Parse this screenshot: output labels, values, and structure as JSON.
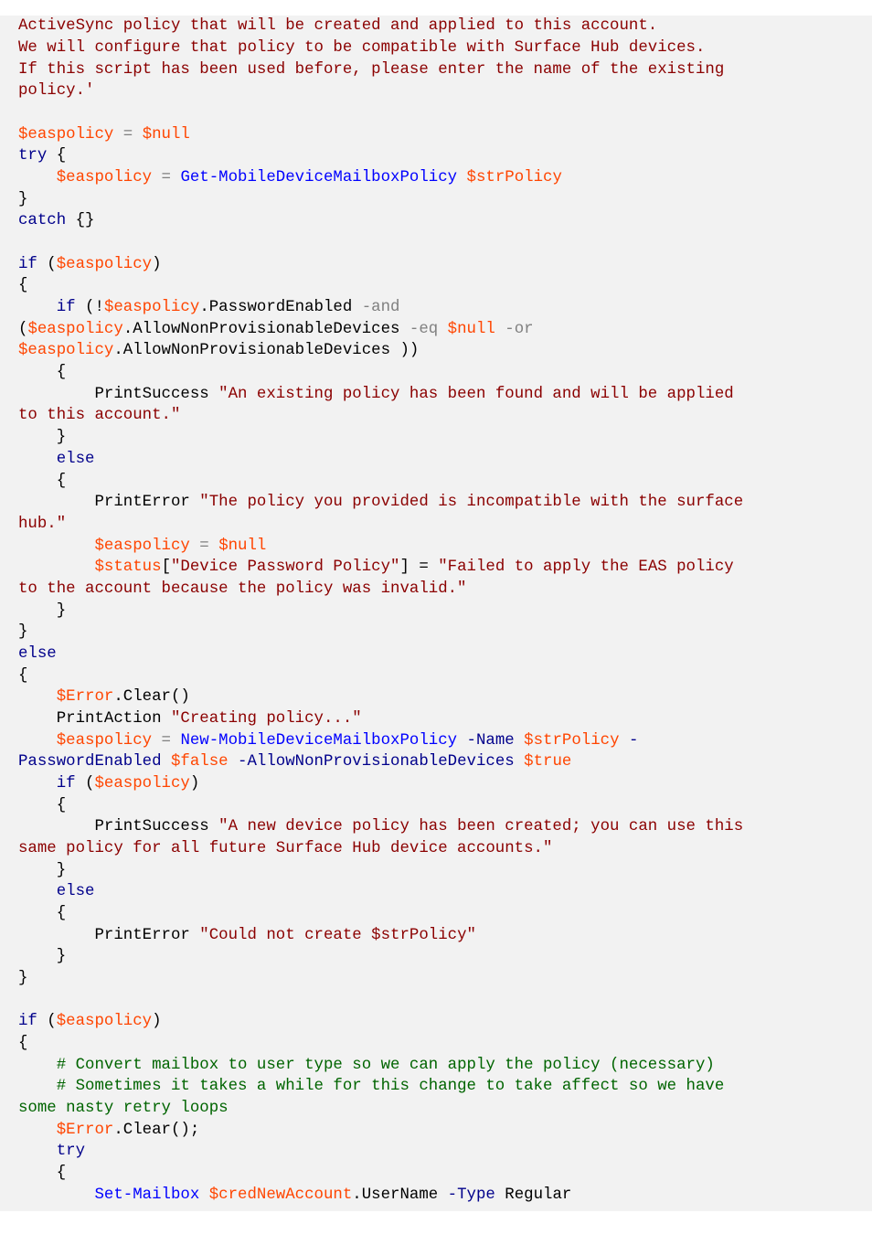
{
  "code": {
    "l01a": "ActiveSync policy that will be created and applied to this account.",
    "l01b": "We will configure that policy to be compatible with Surface Hub devices.",
    "l01c": "If this script has been used before, please enter the name of the existing ",
    "l01d": "policy.'",
    "blank": "",
    "l02_var": "$easpolicy",
    "l02_eq": " = ",
    "l02_null": "$null",
    "l03_try": "try",
    "l03_brace": " {",
    "l04_ind": "    ",
    "l04_var": "$easpolicy",
    "l04_eq": " = ",
    "l04_cmd": "Get-MobileDeviceMailboxPolicy",
    "l04_sp": " ",
    "l04_arg": "$strPolicy",
    "brace_close": "}",
    "l06_catch": "catch",
    "l06_rest": " {}",
    "l08_if": "if",
    "l08_sp": " (",
    "l08_var": "$easpolicy",
    "l08_close": ")",
    "brace_open": "{",
    "l10_ind": "    ",
    "l10_if": "if",
    "l10_a": " (!",
    "l10_var": "$easpolicy",
    "l10_b": ".PasswordEnabled ",
    "l10_and": "-and",
    "l11_a": "(",
    "l11_var": "$easpolicy",
    "l11_b": ".AllowNonProvisionableDevices ",
    "l11_eq": "-eq",
    "l11_sp": " ",
    "l11_null": "$null",
    "l11_sp2": " ",
    "l11_or": "-or",
    "l12_var": "$easpolicy",
    "l12_b": ".AllowNonProvisionableDevices ))",
    "ind4_brace_open": "    {",
    "l14_ind": "        PrintSuccess ",
    "l14_str": "\"An existing policy has been found and will be applied ",
    "l14b_str": "to this account.\"",
    "ind4_brace_close": "    }",
    "l16_ind": "    ",
    "l16_else": "else",
    "l19_ind": "        PrintError ",
    "l19_str": "\"The policy you provided is incompatible with the surface ",
    "l19b_str": "hub.\"",
    "l20_ind": "        ",
    "l20_var": "$easpolicy",
    "l20_eq": " = ",
    "l20_null": "$null",
    "l21_ind": "        ",
    "l21_var": "$status",
    "l21_a": "[",
    "l21_key": "\"Device Password Policy\"",
    "l21_b": "] = ",
    "l21_val": "\"Failed to apply the EAS policy ",
    "l21c_val": "to the account because the policy was invalid.\"",
    "l25_else": "else",
    "l27_ind": "    ",
    "l27_var": "$Error",
    "l27_rest": ".Clear()",
    "l28_ind": "    PrintAction ",
    "l28_str": "\"Creating policy...\"",
    "l29_ind": "    ",
    "l29_var": "$easpolicy",
    "l29_eq": " = ",
    "l29_cmd": "New-MobileDeviceMailboxPolicy",
    "l29_sp": " ",
    "l29_p1": "-Name",
    "l29_sp2": " ",
    "l29_arg": "$strPolicy",
    "l29_sp3": " ",
    "l29_dash": "-",
    "l30_p": "PasswordEnabled",
    "l30_sp": " ",
    "l30_false": "$false",
    "l30_sp2": " ",
    "l30_p2": "-AllowNonProvisionableDevices",
    "l30_sp3": " ",
    "l30_true": "$true",
    "l31_ind": "    ",
    "l31_if": "if",
    "l31_a": " (",
    "l31_var": "$easpolicy",
    "l31_b": ")",
    "l33_ind": "        PrintSuccess ",
    "l33_str": "\"A new device policy has been created; you can use this ",
    "l33b_str": "same policy for all future Surface Hub device accounts.\"",
    "l37_ind": "        PrintError ",
    "l37_str": "\"Could not create $strPolicy\"",
    "l41_if": "if",
    "l41_a": " (",
    "l41_var": "$easpolicy",
    "l41_b": ")",
    "l43_ind": "    ",
    "l43_c": "# Convert mailbox to user type so we can apply the policy (necessary)",
    "l44_ind": "    ",
    "l44_c": "# Sometimes it takes a while for this change to take affect so we have ",
    "l44b_c": "some nasty retry loops",
    "l45_ind": "    ",
    "l45_var": "$Error",
    "l45_rest": ".Clear();",
    "l46_ind": "    ",
    "l46_try": "try",
    "l48_ind": "        ",
    "l48_cmd": "Set-Mailbox",
    "l48_sp": " ",
    "l48_var": "$credNewAccount",
    "l48_rest": ".UserName ",
    "l48_p": "-Type",
    "l48_sp2": " Regular"
  }
}
